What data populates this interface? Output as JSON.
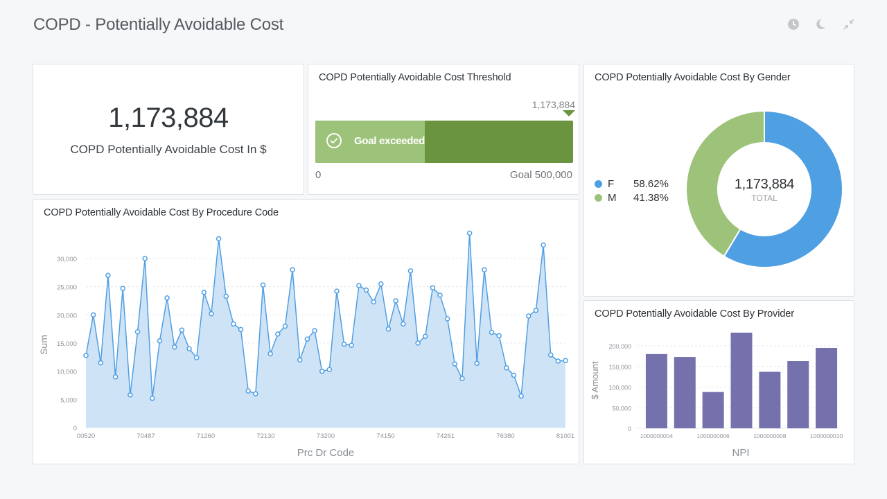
{
  "page": {
    "title": "COPD - Potentially Avoidable Cost",
    "icons": [
      "clock-icon",
      "moon-icon",
      "collapse-icon"
    ]
  },
  "kpi": {
    "value": "1,173,884",
    "label": "COPD Potentially Avoidable Cost In $"
  },
  "threshold": {
    "title": "COPD Potentially Avoidable Cost Threshold",
    "value": 1173884,
    "value_label": "1,173,884",
    "goal": 500000,
    "goal_label": "Goal 500,000",
    "min_label": "0",
    "status": "Goal exceeded",
    "colors": {
      "exceeded": "#6b9440",
      "goal_fill": "#9dc37a"
    }
  },
  "gender": {
    "title": "COPD Potentially Avoidable Cost By Gender",
    "total": "1,173,884",
    "total_label": "TOTAL"
  },
  "procedure": {
    "title": "COPD Potentially Avoidable Cost By Procedure Code"
  },
  "provider": {
    "title": "COPD Potentially Avoidable Cost By Provider"
  },
  "chart_data": [
    {
      "id": "gender",
      "type": "pie",
      "variant": "donut",
      "labels": [
        "F",
        "M"
      ],
      "values": [
        58.62,
        41.38
      ],
      "value_labels": [
        "58.62%",
        "41.38%"
      ],
      "colors": [
        "#4f9fe3",
        "#9dc37a"
      ],
      "legend": "left"
    },
    {
      "id": "procedure",
      "type": "area",
      "xlabel": "Prc Dr Code",
      "ylabel": "Sum",
      "ylim": [
        0,
        30000
      ],
      "yticks": [
        0,
        5000,
        10000,
        15000,
        20000,
        25000,
        30000
      ],
      "ytick_labels": [
        "0",
        "5,000",
        "10,000",
        "15,000",
        "20,000",
        "25,000",
        "30,000"
      ],
      "xtick_labels": [
        "00520",
        "70487",
        "71260",
        "72130",
        "73200",
        "74150",
        "74261",
        "76380",
        "81001"
      ],
      "grid": true,
      "color": "#4f9fe3",
      "fill": "#cfe3f6",
      "values": [
        12800,
        20000,
        11500,
        27000,
        9000,
        24700,
        5800,
        17000,
        30000,
        5200,
        15400,
        23000,
        14300,
        17300,
        14000,
        12400,
        24000,
        20200,
        33500,
        23300,
        18400,
        17400,
        6500,
        6000,
        25300,
        13100,
        16600,
        18000,
        28000,
        12000,
        15700,
        17200,
        10000,
        10300,
        24200,
        14800,
        14600,
        25200,
        24400,
        22300,
        25500,
        17500,
        22500,
        18400,
        27800,
        15000,
        16200,
        24800,
        23500,
        19300,
        11300,
        8700,
        34500,
        11400,
        28000,
        16900,
        16300,
        10600,
        9300,
        5600,
        19800,
        20800,
        32400,
        12900,
        11800,
        11900
      ]
    },
    {
      "id": "provider",
      "type": "bar",
      "xlabel": "NPI",
      "ylabel": "$ Amount",
      "ylim": [
        0,
        230000
      ],
      "yticks": [
        0,
        50000,
        100000,
        150000,
        200000
      ],
      "ytick_labels": [
        "0",
        "50,000",
        "100,000",
        "150,000",
        "200,000"
      ],
      "categories": [
        "1000000004",
        "",
        "1000000006",
        "",
        "1000000008",
        "",
        "1000000010"
      ],
      "values": [
        180000,
        173000,
        88000,
        232000,
        137000,
        163000,
        195000
      ],
      "color": "#7471ad",
      "grid": true
    }
  ]
}
